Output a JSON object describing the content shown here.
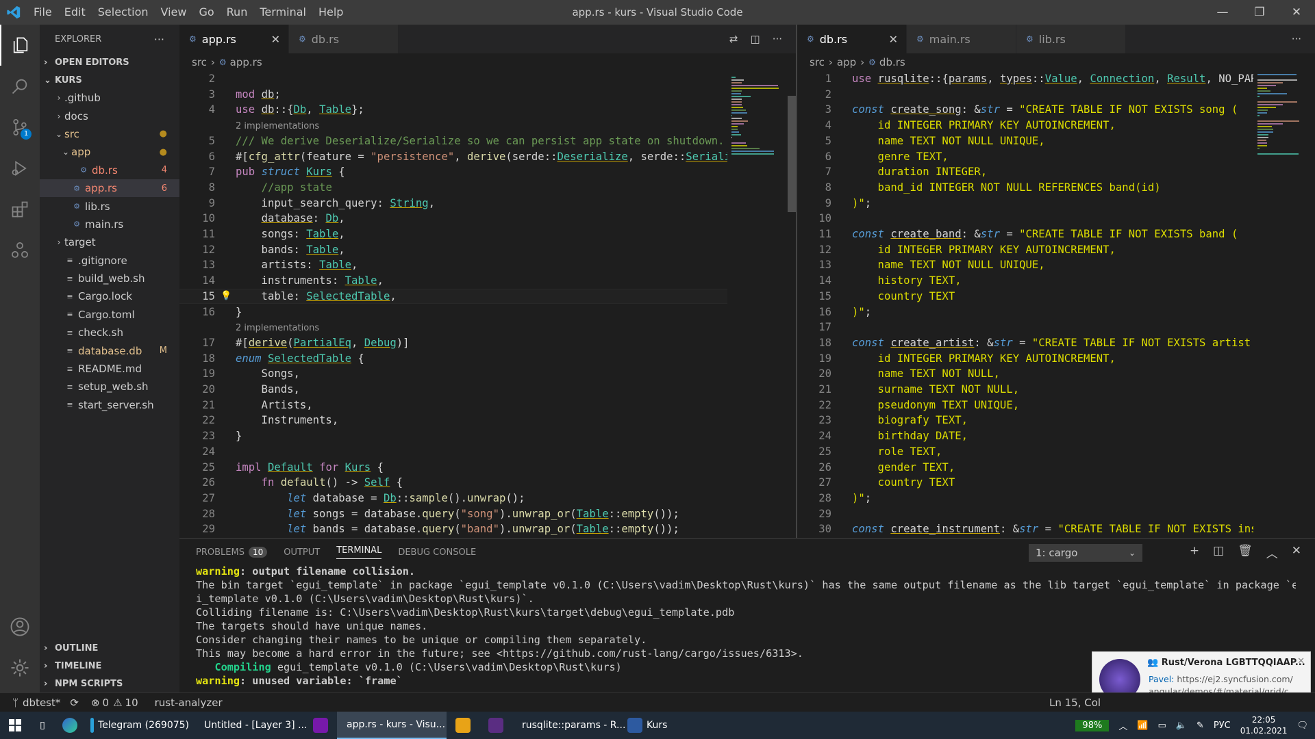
{
  "window": {
    "title": "app.rs - kurs - Visual Studio Code",
    "menu": [
      "File",
      "Edit",
      "Selection",
      "View",
      "Go",
      "Run",
      "Terminal",
      "Help"
    ]
  },
  "activity": {
    "scm_badge": "1"
  },
  "explorer": {
    "header": "EXPLORER",
    "open_editors": "OPEN EDITORS",
    "project": "KURS",
    "items": [
      {
        "label": ".github",
        "depth": 1,
        "type": "folder",
        "open": false
      },
      {
        "label": "docs",
        "depth": 1,
        "type": "folder",
        "open": false
      },
      {
        "label": "src",
        "depth": 1,
        "type": "folder",
        "open": true,
        "dot": "●"
      },
      {
        "label": "app",
        "depth": 2,
        "type": "folder",
        "open": true,
        "dot": "●"
      },
      {
        "label": "db.rs",
        "depth": 3,
        "type": "rs",
        "dec": "4"
      },
      {
        "label": "app.rs",
        "depth": 2,
        "type": "rs",
        "dec": "6",
        "selected": true
      },
      {
        "label": "lib.rs",
        "depth": 2,
        "type": "rs"
      },
      {
        "label": "main.rs",
        "depth": 2,
        "type": "rs"
      },
      {
        "label": "target",
        "depth": 1,
        "type": "folder",
        "open": false
      },
      {
        "label": ".gitignore",
        "depth": 1,
        "type": "file"
      },
      {
        "label": "build_web.sh",
        "depth": 1,
        "type": "file"
      },
      {
        "label": "Cargo.lock",
        "depth": 1,
        "type": "file"
      },
      {
        "label": "Cargo.toml",
        "depth": 1,
        "type": "file"
      },
      {
        "label": "check.sh",
        "depth": 1,
        "type": "file"
      },
      {
        "label": "database.db",
        "depth": 1,
        "type": "file",
        "dec": "M"
      },
      {
        "label": "README.md",
        "depth": 1,
        "type": "file"
      },
      {
        "label": "setup_web.sh",
        "depth": 1,
        "type": "file"
      },
      {
        "label": "start_server.sh",
        "depth": 1,
        "type": "file"
      }
    ],
    "bottom_sections": [
      "OUTLINE",
      "TIMELINE",
      "NPM SCRIPTS"
    ]
  },
  "editor1": {
    "tabs": [
      "app.rs",
      "db.rs"
    ],
    "breadcrumb": [
      "src",
      "app.rs"
    ],
    "lines": [
      {
        "n": "2",
        "h": ""
      },
      {
        "n": "3",
        "h": "<span class='kw2'>mod</span> <span class='u'>db</span>;"
      },
      {
        "n": "4",
        "h": "<span class='kw2'>use</span> <span class='u'>db</span>::{<span class='ty u'>Db</span>, <span class='ty u'>Table</span>};"
      },
      {
        "n": "",
        "h": "<span class='cl'>2 implementations</span>"
      },
      {
        "n": "5",
        "h": "<span class='cm'>/// We derive Deserialize/Serialize so we can persist app state on shutdown.</span>"
      },
      {
        "n": "6",
        "h": "#[<span class='fn'>cfg_attr</span>(feature = <span class='str'>\"persistence\"</span>, <span class='fn'>derive</span>(serde::<span class='ty u'>Deserialize</span>, serde::<span class='ty u'>Seriali</span>"
      },
      {
        "n": "7",
        "h": "<span class='kw2'>pub</span> <span class='kw'><i>struct</i></span> <span class='ty u'>Kurs</span> {"
      },
      {
        "n": "8",
        "h": "    <span class='cm'>//app state</span>"
      },
      {
        "n": "9",
        "h": "    input_search_query: <span class='ty u'>String</span>,"
      },
      {
        "n": "10",
        "h": "    <span class='u'>database</span>: <span class='ty u'>Db</span>,"
      },
      {
        "n": "11",
        "h": "    songs: <span class='ty u'>Table</span>,"
      },
      {
        "n": "12",
        "h": "    bands: <span class='ty u'>Table</span>,"
      },
      {
        "n": "13",
        "h": "    artists: <span class='ty u'>Table</span>,"
      },
      {
        "n": "14",
        "h": "    instruments: <span class='ty u'>Table</span>,"
      },
      {
        "n": "15",
        "h": "    table: <span class='ty u'>SelectedTable</span>,",
        "cur": true
      },
      {
        "n": "16",
        "h": "}"
      },
      {
        "n": "",
        "h": "<span class='cl'>2 implementations</span>"
      },
      {
        "n": "17",
        "h": "#[<span class='fn u'>derive</span>(<span class='ty u'>PartialEq</span>, <span class='ty u'>Debug</span>)]"
      },
      {
        "n": "18",
        "h": "<span class='kw'><i>enum</i></span> <span class='ty u'>SelectedTable</span> {"
      },
      {
        "n": "19",
        "h": "    Songs,"
      },
      {
        "n": "20",
        "h": "    Bands,"
      },
      {
        "n": "21",
        "h": "    Artists,"
      },
      {
        "n": "22",
        "h": "    Instruments,"
      },
      {
        "n": "23",
        "h": "}"
      },
      {
        "n": "24",
        "h": ""
      },
      {
        "n": "25",
        "h": "<span class='kw2'>impl</span> <span class='ty u'>Default</span> <span class='kw2'>for</span> <span class='ty u'>Kurs</span> {"
      },
      {
        "n": "26",
        "h": "    <span class='kw2'>fn</span> <span class='fn'>default</span>() -> <span class='ty u'>Self</span> {"
      },
      {
        "n": "27",
        "h": "        <span class='kw'><i>let</i></span> database = <span class='ty u'>Db</span>::<span class='fn'>sample</span>().<span class='fn'>unwrap</span>();"
      },
      {
        "n": "28",
        "h": "        <span class='kw'><i>let</i></span> songs = database.<span class='fn'>query</span>(<span class='str'>\"song\"</span>).<span class='fn'>unwrap_or</span>(<span class='ty u'>Table</span>::<span class='fn'>empty</span>());"
      },
      {
        "n": "29",
        "h": "        <span class='kw'><i>let</i></span> bands = database.<span class='fn'>query</span>(<span class='str'>\"band\"</span>).<span class='fn'>unwrap_or</span>(<span class='ty u'>Table</span>::<span class='fn'>empty</span>());"
      }
    ]
  },
  "editor2": {
    "tabs": [
      "db.rs",
      "main.rs",
      "lib.rs"
    ],
    "breadcrumb": [
      "src",
      "app",
      "db.rs"
    ],
    "lines": [
      {
        "n": "1",
        "h": "<span class='kw2'>use</span> <span class='u'>rusqlite</span>::{<span class='u'>params</span>, <span class='u'>types</span>::<span class='ty u'>Value</span>, <span class='ty u'>Connection</span>, <span class='ty u'>Result</span>, NO_PAR"
      },
      {
        "n": "2",
        "h": ""
      },
      {
        "n": "3",
        "h": "<span class='kw'><i>const</i></span> <span class='u'>create_song</span>: &amp;<span class='kw'><i>str</i></span> = <span class='sql'>\"CREATE TABLE IF NOT EXISTS song (</span>"
      },
      {
        "n": "4",
        "h": "<span class='sql'>    id INTEGER PRIMARY KEY AUTOINCREMENT,</span>"
      },
      {
        "n": "5",
        "h": "<span class='sql'>    name TEXT NOT NULL UNIQUE,</span>"
      },
      {
        "n": "6",
        "h": "<span class='sql'>    genre TEXT,</span>"
      },
      {
        "n": "7",
        "h": "<span class='sql'>    duration INTEGER,</span>"
      },
      {
        "n": "8",
        "h": "<span class='sql'>    band_id INTEGER NOT NULL REFERENCES band(id)</span>"
      },
      {
        "n": "9",
        "h": "<span class='sql'>)\"</span>;"
      },
      {
        "n": "10",
        "h": ""
      },
      {
        "n": "11",
        "h": "<span class='kw'><i>const</i></span> <span class='u'>create_band</span>: &amp;<span class='kw'><i>str</i></span> = <span class='sql'>\"CREATE TABLE IF NOT EXISTS band (</span>"
      },
      {
        "n": "12",
        "h": "<span class='sql'>    id INTEGER PRIMARY KEY AUTOINCREMENT,</span>"
      },
      {
        "n": "13",
        "h": "<span class='sql'>    name TEXT NOT NULL UNIQUE,</span>"
      },
      {
        "n": "14",
        "h": "<span class='sql'>    history TEXT,</span>"
      },
      {
        "n": "15",
        "h": "<span class='sql'>    country TEXT</span>"
      },
      {
        "n": "16",
        "h": "<span class='sql'>)\"</span>;"
      },
      {
        "n": "17",
        "h": ""
      },
      {
        "n": "18",
        "h": "<span class='kw'><i>const</i></span> <span class='u'>create_artist</span>: &amp;<span class='kw'><i>str</i></span> = <span class='sql'>\"CREATE TABLE IF NOT EXISTS artist (</span>"
      },
      {
        "n": "19",
        "h": "<span class='sql'>    id INTEGER PRIMARY KEY AUTOINCREMENT,</span>"
      },
      {
        "n": "20",
        "h": "<span class='sql'>    name TEXT NOT NULL,</span>"
      },
      {
        "n": "21",
        "h": "<span class='sql'>    surname TEXT NOT NULL,</span>"
      },
      {
        "n": "22",
        "h": "<span class='sql'>    pseudonym TEXT UNIQUE,</span>"
      },
      {
        "n": "23",
        "h": "<span class='sql'>    biografy TEXT,</span>"
      },
      {
        "n": "24",
        "h": "<span class='sql'>    birthday DATE,</span>"
      },
      {
        "n": "25",
        "h": "<span class='sql'>    role TEXT,</span>"
      },
      {
        "n": "26",
        "h": "<span class='sql'>    gender TEXT,</span>"
      },
      {
        "n": "27",
        "h": "<span class='sql'>    country TEXT</span>"
      },
      {
        "n": "28",
        "h": "<span class='sql'>)\"</span>;"
      },
      {
        "n": "29",
        "h": ""
      },
      {
        "n": "30",
        "h": "<span class='kw'><i>const</i></span> <span class='u'>create_instrument</span>: &amp;<span class='kw'><i>str</i></span> = <span class='sql'>\"CREATE TABLE IF NOT EXISTS ins</span>"
      }
    ]
  },
  "panel": {
    "tabs": [
      "PROBLEMS",
      "OUTPUT",
      "TERMINAL",
      "DEBUG CONSOLE"
    ],
    "problems_count": "10",
    "terminal_select": "1: cargo",
    "terminal_lines": [
      "<b style='color:#e5e510'>warning</b><b>: output filename collision.</b>",
      "The bin target `egui_template` in package `egui_template v0.1.0 (C:\\Users\\vadim\\Desktop\\Rust\\kurs)` has the same output filename as the lib target `egui_template` in package `egu",
      "i_template v0.1.0 (C:\\Users\\vadim\\Desktop\\Rust\\kurs)`.",
      "Colliding filename is: C:\\Users\\vadim\\Desktop\\Rust\\kurs\\target\\debug\\egui_template.pdb",
      "The targets should have unique names.",
      "Consider changing their names to be unique or compiling them separately.",
      "This may become a hard error in the future; see &lt;https://github.com/rust-lang/cargo/issues/6313&gt;.",
      "   <b style='color:#23d18b'>Compiling</b> egui_template v0.1.0 (C:\\Users\\vadim\\Desktop\\Rust\\kurs)",
      "<b style='color:#e5e510'>warning</b><b>: unused variable: `frame`</b>"
    ]
  },
  "statusbar": {
    "branch": "dbtest*",
    "errors": "0",
    "warnings": "10",
    "extension": "rust-analyzer",
    "position": "Ln 15, Col"
  },
  "notification": {
    "title": "Rust/Verona LGBTTQQIAAP...",
    "sender": "Pavel:",
    "text1": "https://ej2.syncfusion.com/",
    "text2": "angular/demos/#/material/grid/c..."
  },
  "taskbar": {
    "apps": [
      {
        "label": "Telegram (269075)",
        "active": false
      },
      {
        "label": "Untitled - [Layer 3] ...",
        "active": false
      },
      {
        "label": "",
        "icon": "N"
      },
      {
        "label": "app.rs - kurs - Visu...",
        "active": true
      },
      {
        "label": "",
        "icon": "folder"
      },
      {
        "label": "",
        "icon": "app"
      },
      {
        "label": "rusqlite::params - R...",
        "active": false
      },
      {
        "label": "Kurs",
        "active": false
      }
    ],
    "battery": "98%",
    "lang": "РУС",
    "time": "22:05",
    "date": "01.02.2021"
  }
}
